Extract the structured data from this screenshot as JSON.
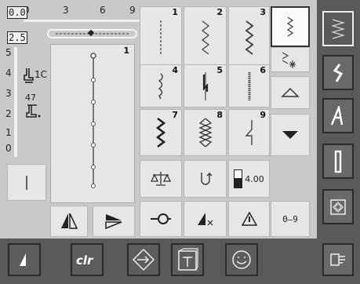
{
  "ruler": {
    "h_box": "0.0",
    "h_ticks": [
      "0",
      "3",
      "6",
      "9"
    ],
    "v_box": "2.5",
    "v_ticks": [
      "5",
      "4",
      "3",
      "2",
      "1",
      "0"
    ]
  },
  "preview": {
    "number": "1"
  },
  "presser": {
    "foot": "1C",
    "tension": "47"
  },
  "stitches": [
    {
      "num": "1",
      "icon": "straight-stitch-icon"
    },
    {
      "num": "2",
      "icon": "zigzag-icon"
    },
    {
      "num": "3",
      "icon": "vari-overlock-icon"
    },
    {
      "num": "4",
      "icon": "running-stitch-icon"
    },
    {
      "num": "5",
      "icon": "securing-stitch-icon"
    },
    {
      "num": "6",
      "icon": "triple-straight-icon"
    },
    {
      "num": "7",
      "icon": "triple-zigzag-icon"
    },
    {
      "num": "8",
      "icon": "honeycomb-icon"
    },
    {
      "num": "9",
      "icon": "blindstitch-icon"
    }
  ],
  "length_value": "4.00",
  "keypad_label": "0–9",
  "colors": {
    "panel": "#5a5a5a",
    "main": "#c9c9c9",
    "cell": "#e6e6e6"
  }
}
